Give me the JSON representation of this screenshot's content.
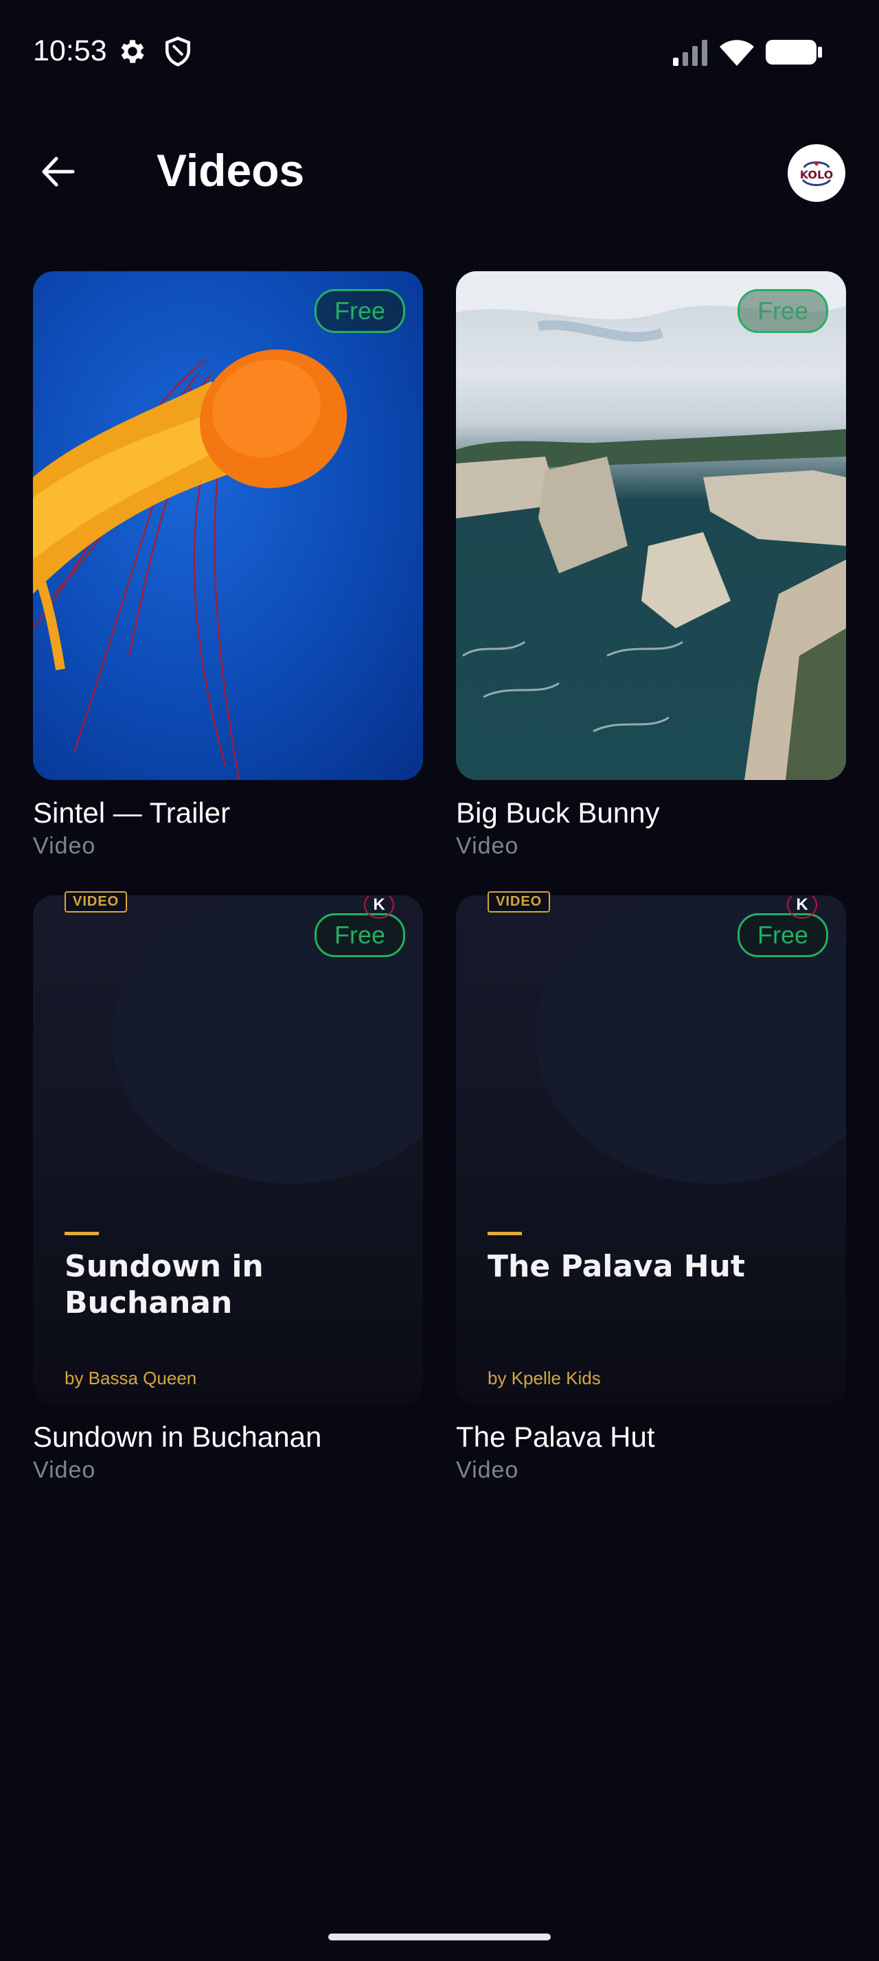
{
  "status_bar": {
    "time": "10:53",
    "icons": [
      "gear-icon",
      "shield-icon",
      "signal-icon",
      "wifi-icon",
      "battery-icon"
    ]
  },
  "app_bar": {
    "title": "Videos",
    "back_icon": "arrow-left-icon",
    "avatar_text": "KOLO"
  },
  "videos": [
    {
      "title": "Sintel — Trailer",
      "subtitle": "Video",
      "badge": "Free",
      "thumbnail": "jellyfish-photo"
    },
    {
      "title": "Big Buck Bunny",
      "subtitle": "Video",
      "badge": "Free",
      "thumbnail": "coastal-cliffs-photo"
    },
    {
      "title": "Sundown in Buchanan",
      "subtitle": "Video",
      "badge": "Free",
      "poster_tag": "VIDEO",
      "poster_title": "Sundown in Buchanan",
      "poster_by": "by Bassa Queen",
      "poster_logo": "K"
    },
    {
      "title": "The Palava Hut",
      "subtitle": "Video",
      "badge": "Free",
      "poster_tag": "VIDEO",
      "poster_title": "The Palava Hut",
      "poster_by": "by Kpelle Kids",
      "poster_logo": "K"
    }
  ],
  "colors": {
    "background": "#070812",
    "badge_green": "#23b061",
    "accent_gold": "#d8a63e",
    "subtitle_gray": "#7f8393"
  }
}
